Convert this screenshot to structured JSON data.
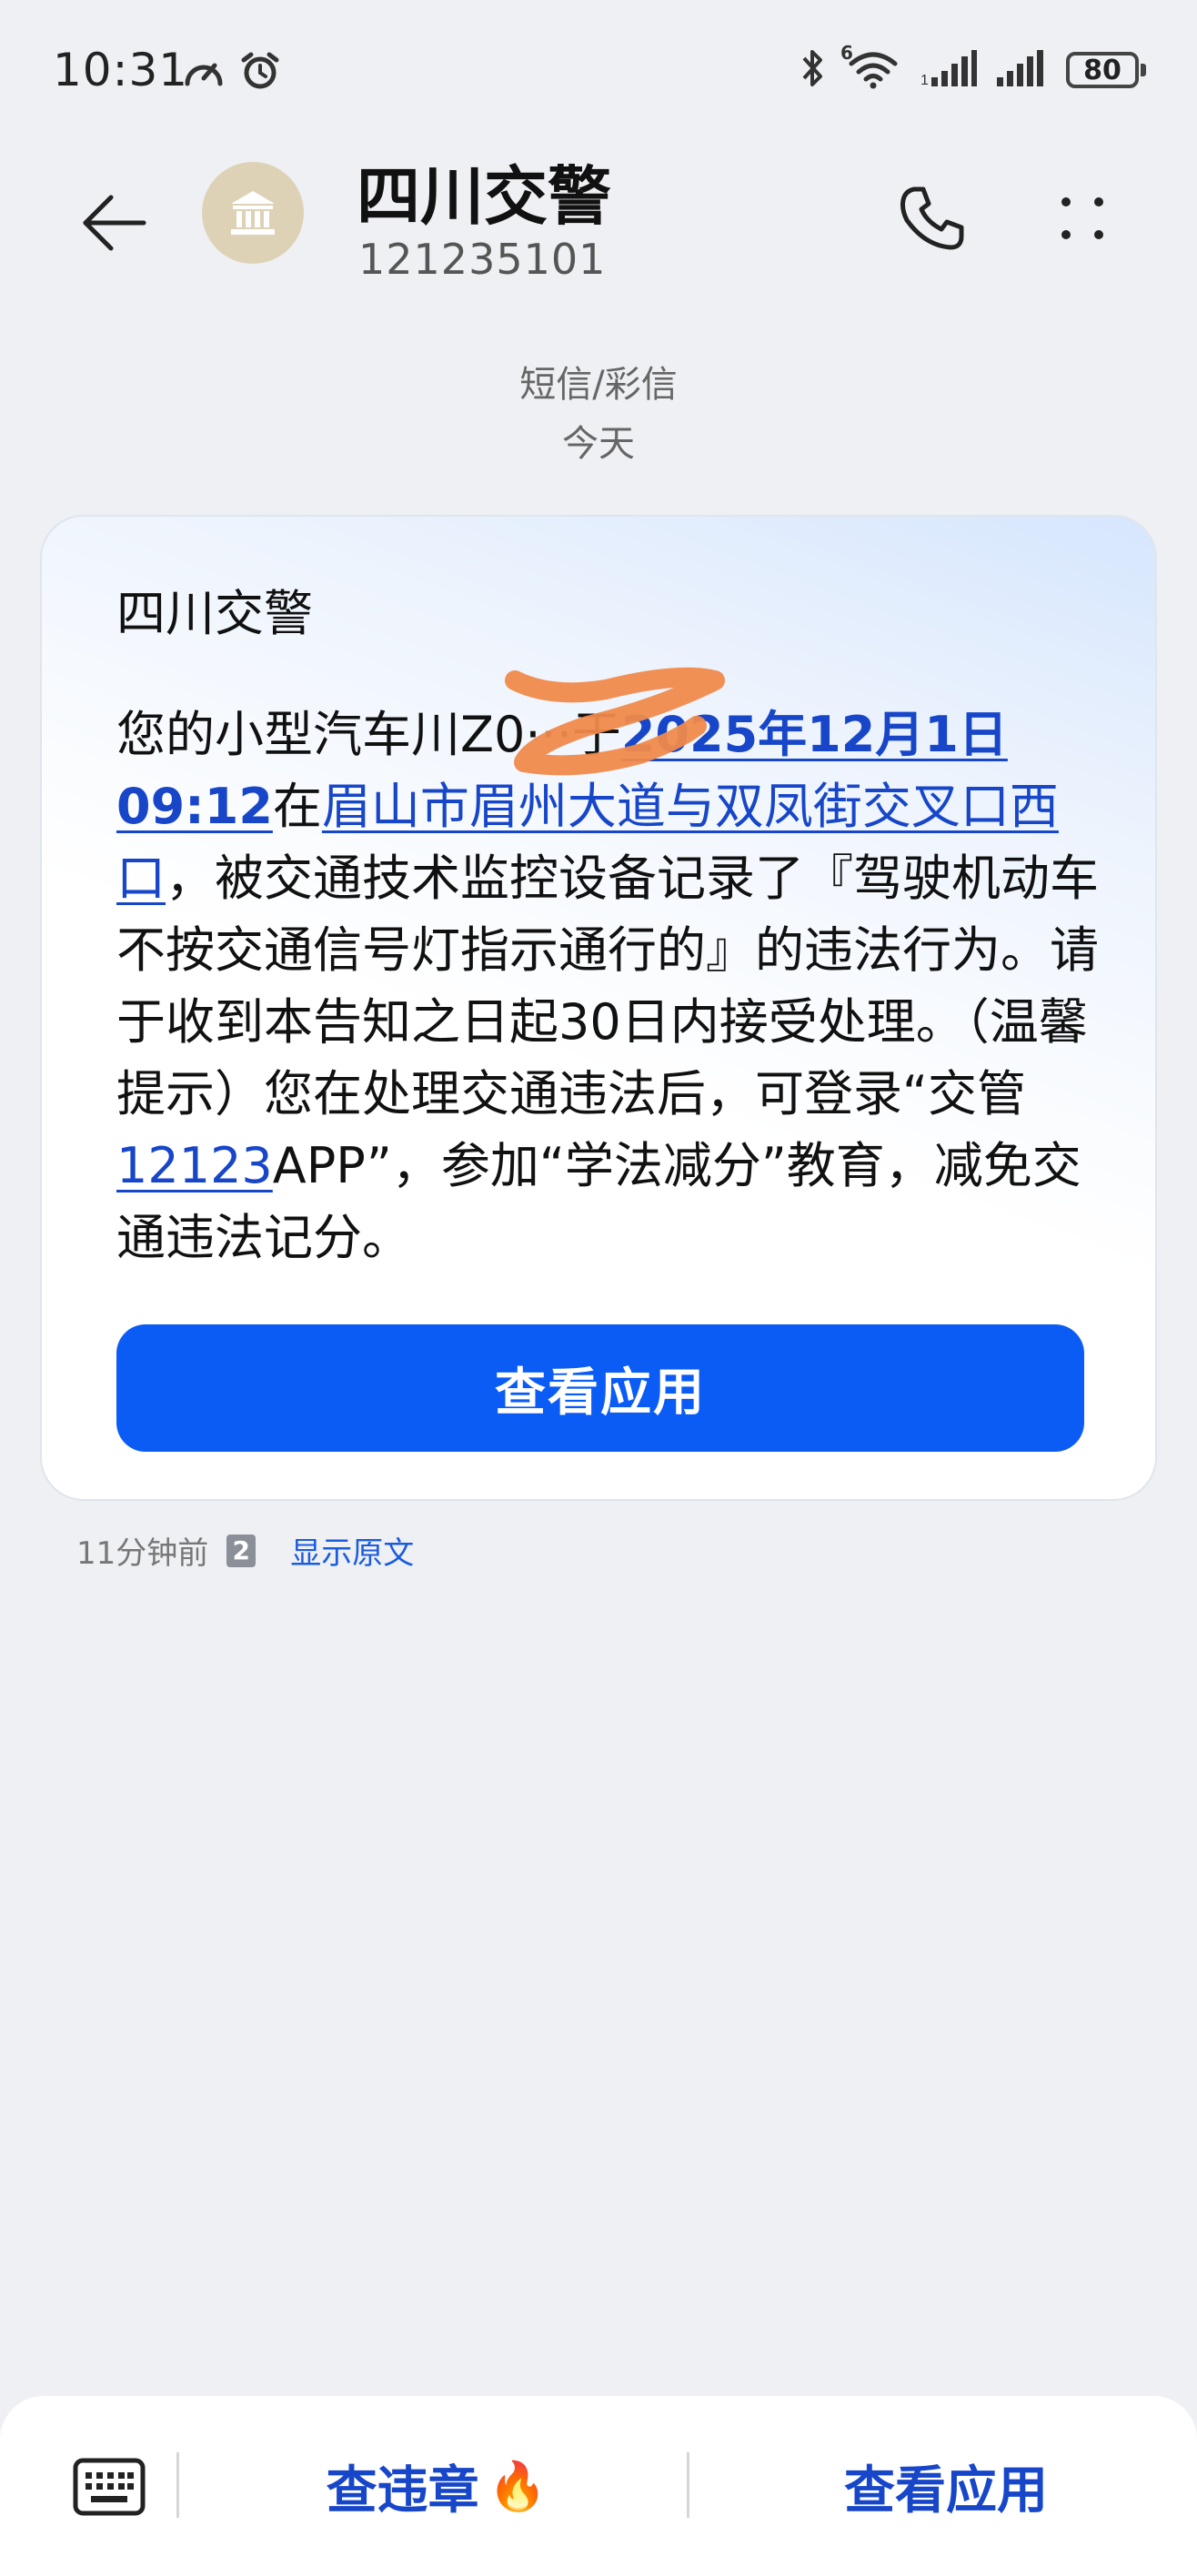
{
  "status_bar": {
    "time": "10:31",
    "battery": "80",
    "network_label": "6"
  },
  "header": {
    "contact_name": "四川交警",
    "contact_number": "121235101"
  },
  "thread": {
    "message_type": "短信/彩信",
    "date_label": "今天"
  },
  "message": {
    "sender": "四川交警",
    "body_prefix": "您的小型汽车川Z0",
    "body_masked": "···",
    "body_yu": "于",
    "date_link": "2025年12月1日09:12",
    "body_zai": "在",
    "location_link": "眉山市眉州大道与双凤街交叉口西口",
    "body_middle": "，被交通技术监控设备记录了『驾驶机动车不按交通信号灯指示通行的』的违法行为。请于收到本告知之日起30日内接受处理。（温馨提示）您在处理交通违法后，可登录“交管",
    "app_link": "12123",
    "body_suffix": "APP”，参加“学法减分”教育，减免交通违法记分。",
    "action_label": "查看应用",
    "time_ago": "11分钟前",
    "sim": "2",
    "show_original": "显示原文"
  },
  "bottom_bar": {
    "action_1": "查违章",
    "action_1_emoji": "🔥",
    "action_2": "查看应用"
  },
  "colors": {
    "accent": "#0a5cf5",
    "link": "#1746c9",
    "background": "#eef0f3",
    "scribble": "#f08a4b"
  }
}
